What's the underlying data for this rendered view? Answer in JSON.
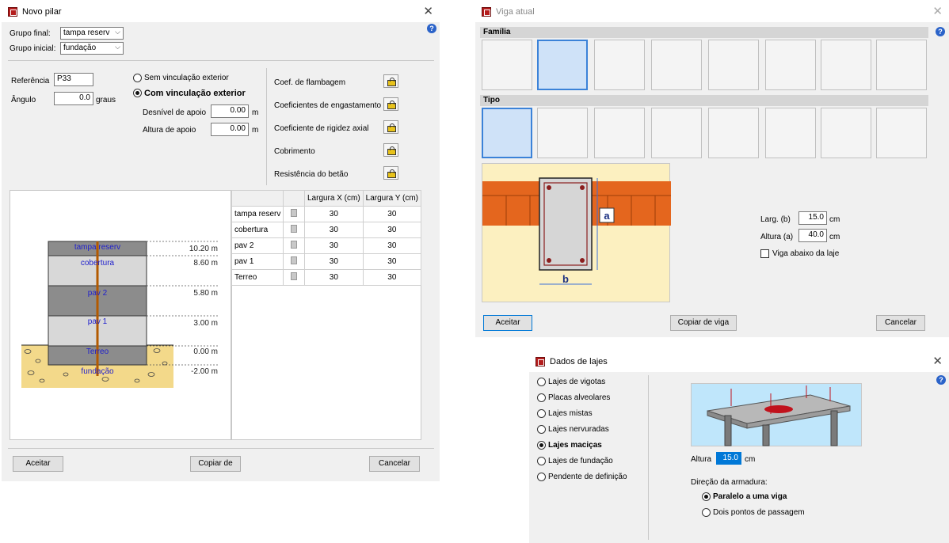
{
  "win1": {
    "title": "Novo pilar",
    "grupo_final_label": "Grupo final:",
    "grupo_final_value": "tampa reserv",
    "grupo_inicial_label": "Grupo inicial:",
    "grupo_inicial_value": "fundação",
    "referencia_label": "Referência",
    "referencia_value": "P33",
    "angulo_label": "Ângulo",
    "angulo_value": "0.0",
    "angulo_unit": "graus",
    "radio_sem": "Sem vinculação exterior",
    "radio_com": "Com vinculação exterior",
    "desnivel_label": "Desnível de apoio",
    "desnivel_value": "0.00",
    "altura_label": "Altura de apoio",
    "altura_value": "0.00",
    "unit_m": "m",
    "props": [
      "Coef. de flambagem",
      "Coeficientes de engastamento",
      "Coeficiente de rigidez axial",
      "Cobrimento",
      "Resistência do betão"
    ],
    "table": {
      "headers": [
        "",
        "",
        "Largura X (cm)",
        "Largura Y (cm)"
      ],
      "rows": [
        {
          "name": "tampa reserv",
          "x": "30",
          "y": "30"
        },
        {
          "name": "cobertura",
          "x": "30",
          "y": "30"
        },
        {
          "name": "pav 2",
          "x": "30",
          "y": "30"
        },
        {
          "name": "pav 1",
          "x": "30",
          "y": "30"
        },
        {
          "name": "Terreo",
          "x": "30",
          "y": "30"
        }
      ]
    },
    "levels": [
      {
        "name": "tampa reserv",
        "elev": "10.20 m"
      },
      {
        "name": "cobertura",
        "elev": "8.60 m"
      },
      {
        "name": "pav 2",
        "elev": "5.80 m"
      },
      {
        "name": "pav 1",
        "elev": "3.00 m"
      },
      {
        "name": "Terreo",
        "elev": "0.00 m"
      },
      {
        "name": "fundação",
        "elev": "-2.00 m"
      }
    ],
    "btn_ok": "Aceitar",
    "btn_copy": "Copiar de",
    "btn_cancel": "Cancelar"
  },
  "win2": {
    "title": "Viga atual",
    "familia": "Família",
    "tipo": "Tipo",
    "dim_a": "a",
    "dim_b": "b",
    "larg_label": "Larg. (b)",
    "larg_value": "15.0",
    "altura_label": "Altura (a)",
    "altura_value": "40.0",
    "unit": "cm",
    "check_label": "Viga abaixo da laje",
    "btn_ok": "Aceitar",
    "btn_copy": "Copiar de viga",
    "btn_cancel": "Cancelar"
  },
  "win3": {
    "title": "Dados de lajes",
    "options": [
      "Lajes de vigotas",
      "Placas alveolares",
      "Lajes mistas",
      "Lajes nervuradas",
      "Lajes maciças",
      "Lajes de fundação",
      "Pendente de definição"
    ],
    "selected_index": 4,
    "altura_label": "Altura",
    "altura_value": "15.0",
    "unit": "cm",
    "direcao_label": "Direção da armadura:",
    "dir_opt1": "Paralelo a uma viga",
    "dir_opt2": "Dois pontos de passagem"
  },
  "colors": {
    "accent": "#0078d7",
    "title_icon": "#b51d1d",
    "column": "#b0b0b0",
    "soil": "#f3d98a",
    "wall": "#e4661e"
  }
}
